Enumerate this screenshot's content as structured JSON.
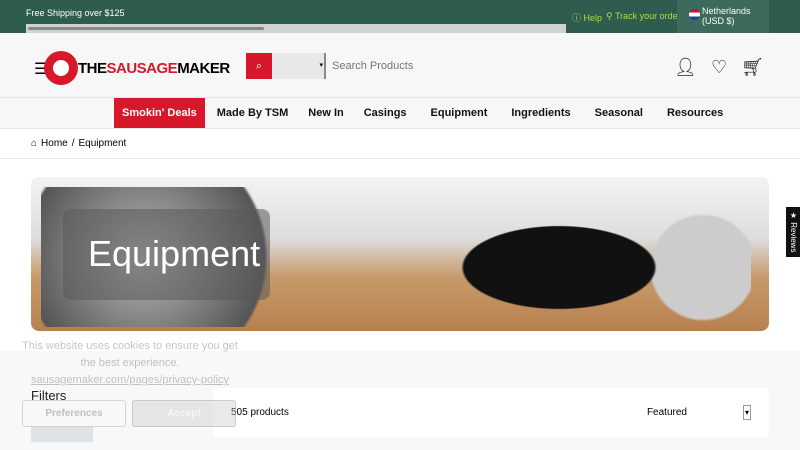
{
  "topbar": {
    "shipping": "Free Shipping over $125",
    "help": "Help",
    "track": "Track your order",
    "country": "Netherlands",
    "currency": "(USD $)"
  },
  "header": {
    "logo_the": "THE",
    "logo_sausage": "SAUSAGE",
    "logo_maker": "MAKER",
    "search_placeholder": "Search Products",
    "select_value": ""
  },
  "nav": [
    "Smokin' Deals",
    "Made By TSM",
    "New In",
    "Casings",
    "Equipment",
    "Ingredients",
    "Seasonal",
    "Resources"
  ],
  "breadcrumb": {
    "home": "Home",
    "sep": "/",
    "current": "Equipment"
  },
  "hero": {
    "title": "Equipment"
  },
  "cookie": {
    "text1": "This website uses cookies to ensure you get",
    "text2": "the best experience.",
    "link": "sausagemaker.com/pages/privacy-policy",
    "preferences": "Preferences",
    "accept": "Accept"
  },
  "listing": {
    "filters": "Filters",
    "count": "505 products",
    "sort": "Featured"
  },
  "reviews": "★ Reviews",
  "colors": {
    "brand_red": "#d7182a",
    "topbar_green": "#2e5c4f",
    "link_green": "#b5d94a"
  }
}
